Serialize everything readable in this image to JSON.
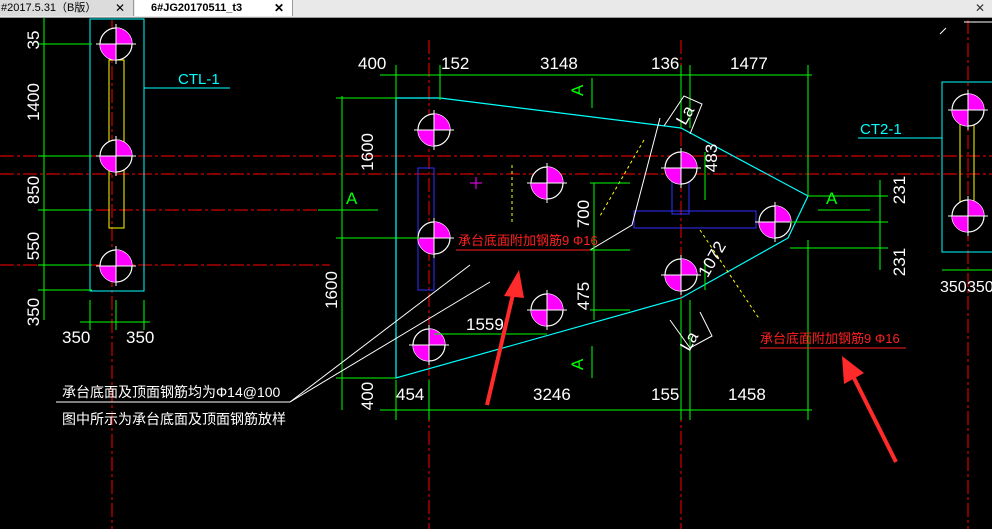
{
  "tabs": [
    {
      "label": "#2017.5.31（B版）",
      "close": "✕"
    },
    {
      "label": "6#JG20170511_t3",
      "close": "✕"
    }
  ],
  "window_close": "✕",
  "colors": {
    "background": "#000000",
    "dimension": "#00ff00",
    "outline": "#00ffff",
    "grid_axis": "#ff0000",
    "pile_fill": "#ff00ff",
    "annotation": "#ff2020",
    "leader": "#ffffff",
    "rebar": "#ffff00",
    "beam": "#0000ff"
  },
  "drawing": {
    "left_cap": {
      "label": "CTL-1",
      "dims_vertical": [
        "35",
        "1400",
        "850",
        "550",
        "350"
      ],
      "dims_bottom": [
        "350",
        "350"
      ]
    },
    "right_cap": {
      "label": "CT2-1",
      "dims_bottom": [
        "350",
        "350"
      ]
    },
    "main_cap": {
      "dims_top": [
        "400",
        "152",
        "3148",
        "136",
        "1477"
      ],
      "dims_bottom": [
        "454",
        "3246",
        "155",
        "1458"
      ],
      "dims_left": [
        "1600",
        "1600",
        "400"
      ],
      "dims_right": [
        "231",
        "231"
      ],
      "dims_inner": [
        "700",
        "475",
        "1559",
        "483",
        "1072"
      ],
      "leg_marks": [
        "La",
        "La"
      ],
      "section_marks": [
        "A",
        "A",
        "A",
        "A"
      ]
    },
    "notes": {
      "additional_rebar_1": "承台底面附加钢筋9 Φ16",
      "additional_rebar_2": "承台底面附加钢筋9 Φ16",
      "main_rebar": "承台底面及顶面钢筋均为Φ14@100",
      "note_line2": "图中所示为承台底面及顶面钢筋放样"
    }
  }
}
